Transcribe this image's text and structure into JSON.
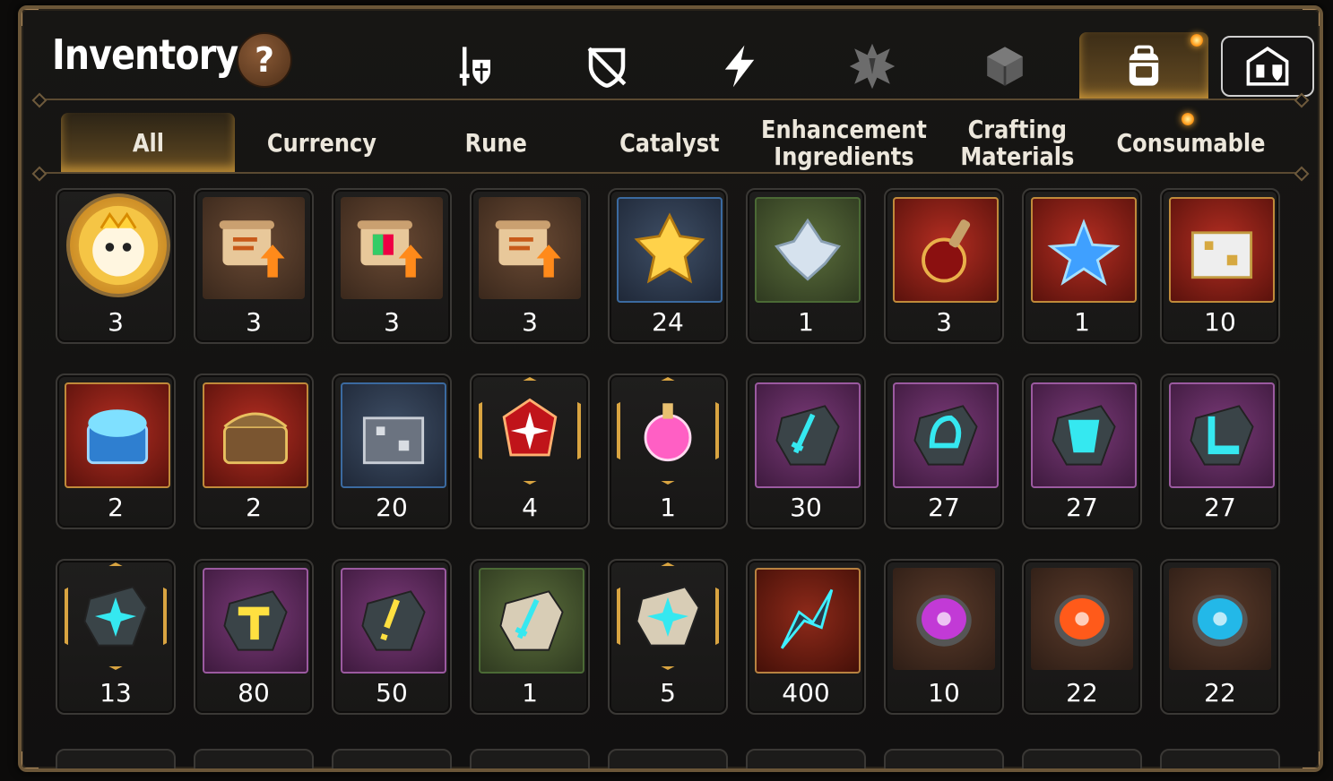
{
  "header": {
    "title": "Inventory",
    "help_label": "?"
  },
  "top_tabs": [
    {
      "name": "equipment-tab",
      "icon": "sword-shield-icon",
      "active": false
    },
    {
      "name": "disabled-tab",
      "icon": "crossed-shield-icon",
      "active": false
    },
    {
      "name": "energy-tab",
      "icon": "lightning-icon",
      "active": false
    },
    {
      "name": "spiky-tab",
      "icon": "spiky-badge-icon",
      "active": false
    },
    {
      "name": "cube-tab",
      "icon": "cube-icon",
      "active": false
    },
    {
      "name": "backpack-tab",
      "icon": "backpack-icon",
      "active": true
    },
    {
      "name": "guild-tab",
      "icon": "castle-icon",
      "active": false
    }
  ],
  "category_tabs": [
    {
      "label": "All",
      "active": true
    },
    {
      "label": "Currency",
      "active": false
    },
    {
      "label": "Rune",
      "active": false
    },
    {
      "label": "Catalyst",
      "active": false
    },
    {
      "label": "Enhancement\nIngredients",
      "active": false
    },
    {
      "label": "Crafting\nMaterials",
      "active": false
    },
    {
      "label": "Consumable",
      "active": false
    }
  ],
  "items": [
    {
      "icon": "hero-portrait-coin-icon",
      "qty": "3"
    },
    {
      "icon": "scroll-upgrade-icon",
      "qty": "3"
    },
    {
      "icon": "rainbow-scroll-upgrade-icon",
      "qty": "3"
    },
    {
      "icon": "scroll-upgrade-icon",
      "qty": "3"
    },
    {
      "icon": "gold-crystal-cluster-icon",
      "qty": "24"
    },
    {
      "icon": "silver-crystal-flower-icon",
      "qty": "1"
    },
    {
      "icon": "red-potion-flask-icon",
      "qty": "3"
    },
    {
      "icon": "blue-star-potion-icon",
      "qty": "1"
    },
    {
      "icon": "gold-chest-box-icon",
      "qty": "10"
    },
    {
      "icon": "blue-glowing-chest-icon",
      "qty": "2"
    },
    {
      "icon": "gold-treasure-chest-icon",
      "qty": "2"
    },
    {
      "icon": "silver-chest-box-icon",
      "qty": "20"
    },
    {
      "icon": "red-sparkle-gem-icon",
      "qty": "4"
    },
    {
      "icon": "pink-potion-hex-icon",
      "qty": "1"
    },
    {
      "icon": "sword-rune-stone-icon",
      "qty": "30"
    },
    {
      "icon": "helmet-rune-stone-icon",
      "qty": "27"
    },
    {
      "icon": "armor-rune-stone-icon",
      "qty": "27"
    },
    {
      "icon": "boot-rune-stone-icon",
      "qty": "27"
    },
    {
      "icon": "star-rune-stone-hex-icon",
      "qty": "13"
    },
    {
      "icon": "gold-hammer-rune-stone-icon",
      "qty": "80"
    },
    {
      "icon": "gold-exclaim-rune-stone-icon",
      "qty": "50"
    },
    {
      "icon": "white-sword-stone-icon",
      "qty": "1"
    },
    {
      "icon": "white-star-stone-hex-icon",
      "qty": "5"
    },
    {
      "icon": "dark-crystal-shard-icon",
      "qty": "400"
    },
    {
      "icon": "purple-orb-disc-icon",
      "qty": "10"
    },
    {
      "icon": "orange-orb-disc-icon",
      "qty": "22"
    },
    {
      "icon": "cyan-orb-disc-icon",
      "qty": "22"
    }
  ],
  "colors": {
    "accent": "#d9a441",
    "frame": "#6b5638",
    "text": "#f2efe8"
  }
}
